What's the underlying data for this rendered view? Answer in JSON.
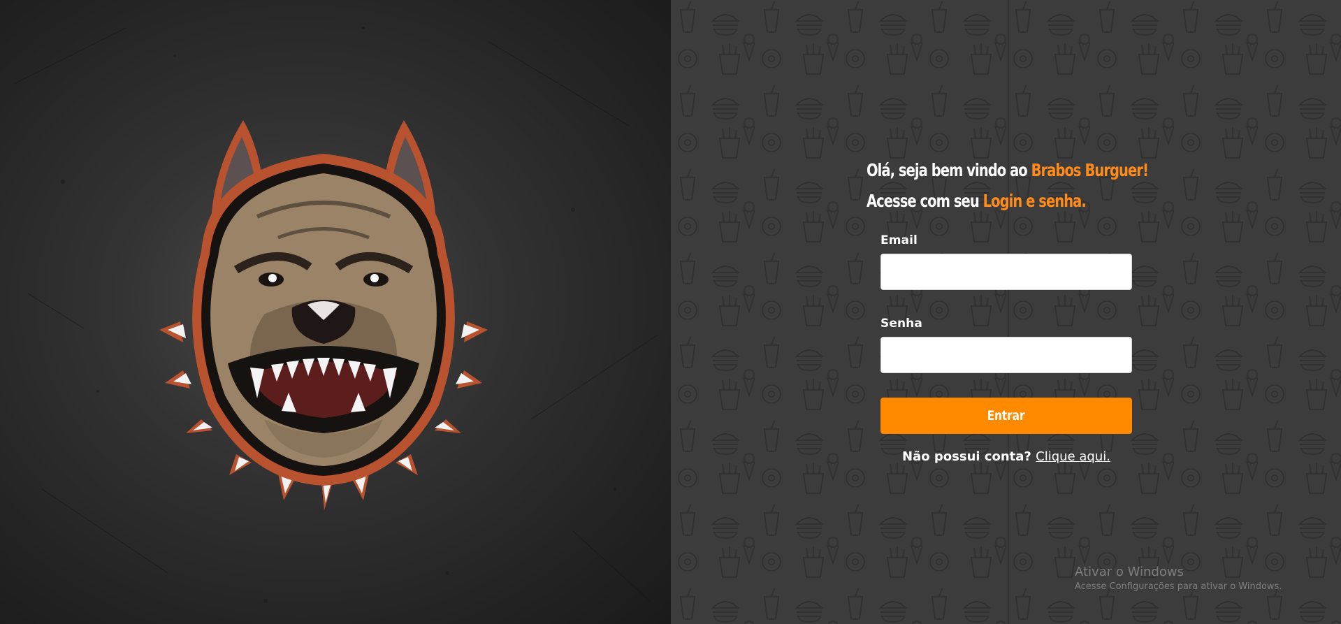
{
  "welcome": {
    "line1_prefix": "Olá, seja bem vindo ao ",
    "line1_brand": "Brabos Burguer!",
    "line2_prefix": "Acesse com seu ",
    "line2_accent": "Login e senha."
  },
  "form": {
    "email_label": "Email",
    "email_value": "",
    "password_label": "Senha",
    "password_value": "",
    "submit_label": "Entrar",
    "signup_prompt": "Não possui conta?",
    "signup_link": "Clique aqui."
  },
  "watermark": {
    "title": "Ativar o Windows",
    "subtitle": "Acesse Configurações para ativar o Windows."
  },
  "colors": {
    "accent": "#ff8a00",
    "left_background": "#2a2a2a",
    "right_background": "#3c3c3c",
    "text": "#ffffff"
  },
  "icons": {
    "logo": "pitbull-mascot-icon",
    "background_pattern": "food-doodle-pattern"
  }
}
